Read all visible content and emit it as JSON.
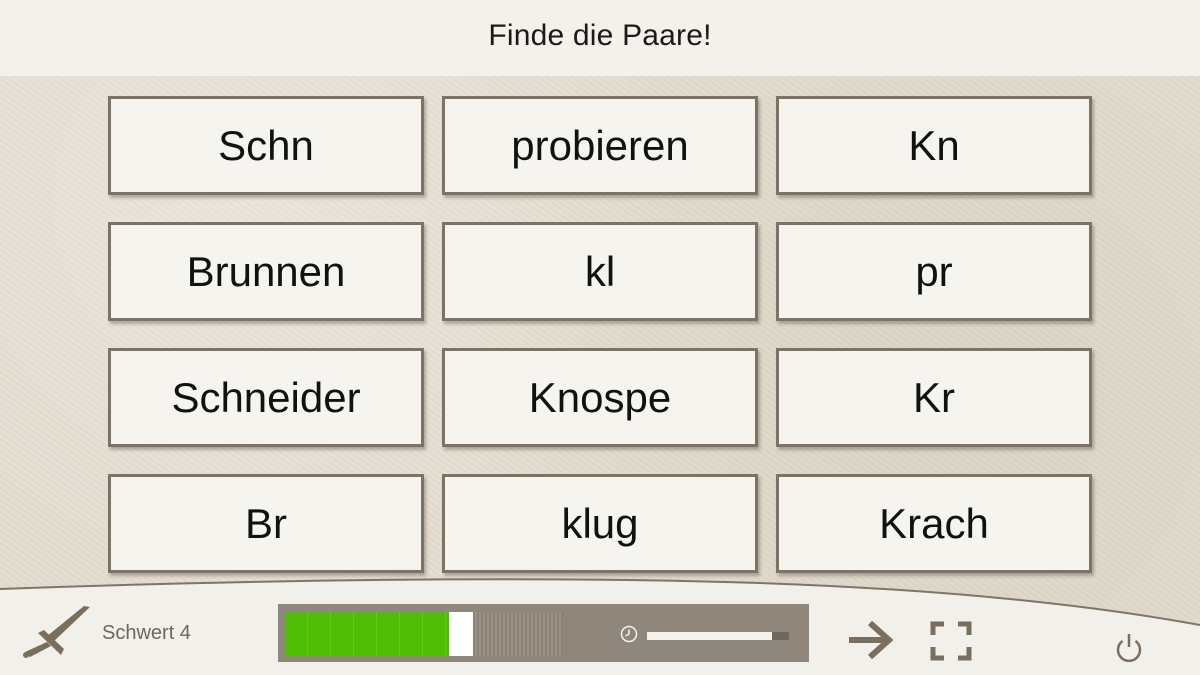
{
  "header": {
    "title": "Finde die Paare!"
  },
  "cards": [
    {
      "label": "Schn"
    },
    {
      "label": "probieren"
    },
    {
      "label": "Kn"
    },
    {
      "label": "Brunnen"
    },
    {
      "label": "kl"
    },
    {
      "label": "pr"
    },
    {
      "label": "Schneider"
    },
    {
      "label": "Knospe"
    },
    {
      "label": "Kr"
    },
    {
      "label": "Br"
    },
    {
      "label": "klug"
    },
    {
      "label": "Krach"
    }
  ],
  "footer": {
    "level_icon": "sword-icon",
    "level_label": "Schwert 4",
    "progress": {
      "completed_fraction": 0.59,
      "current_fraction": 0.086
    },
    "timer": {
      "icon": "clock-icon",
      "remaining_fraction": 0.88
    },
    "controls": [
      "next-arrow-icon",
      "fullscreen-icon",
      "power-icon"
    ]
  },
  "colors": {
    "background": "#e3ddd0",
    "header": "#f3f1ea",
    "card": "#f6f4ef",
    "card_border": "#7d7364",
    "progress_green": "#4fbc05",
    "icon": "#7a6e5d"
  }
}
